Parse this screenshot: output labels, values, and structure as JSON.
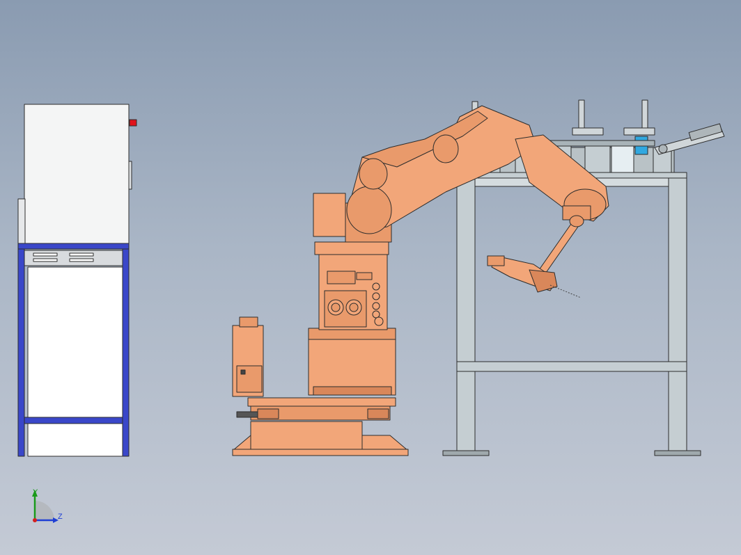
{
  "viewport": {
    "background_top": "#8a9bb1",
    "background_bottom": "#c4cad5"
  },
  "colors": {
    "robot": "#f2a679",
    "robot_shade": "#d9875a",
    "frame": "#c5ced2",
    "frame_dark": "#9fa9ad",
    "cabinet_frame": "#3a47c9",
    "cabinet_body": "#f4f5f5",
    "warning_red": "#e0121b",
    "triad_x": "#d41f1f",
    "triad_y": "#1a9a1a",
    "triad_z": "#1f3fd4",
    "fixture_blue": "#31a8e0"
  },
  "triad": {
    "y_label": "Y",
    "z_label": "Z",
    "icon": "coordinate-triad-icon"
  }
}
